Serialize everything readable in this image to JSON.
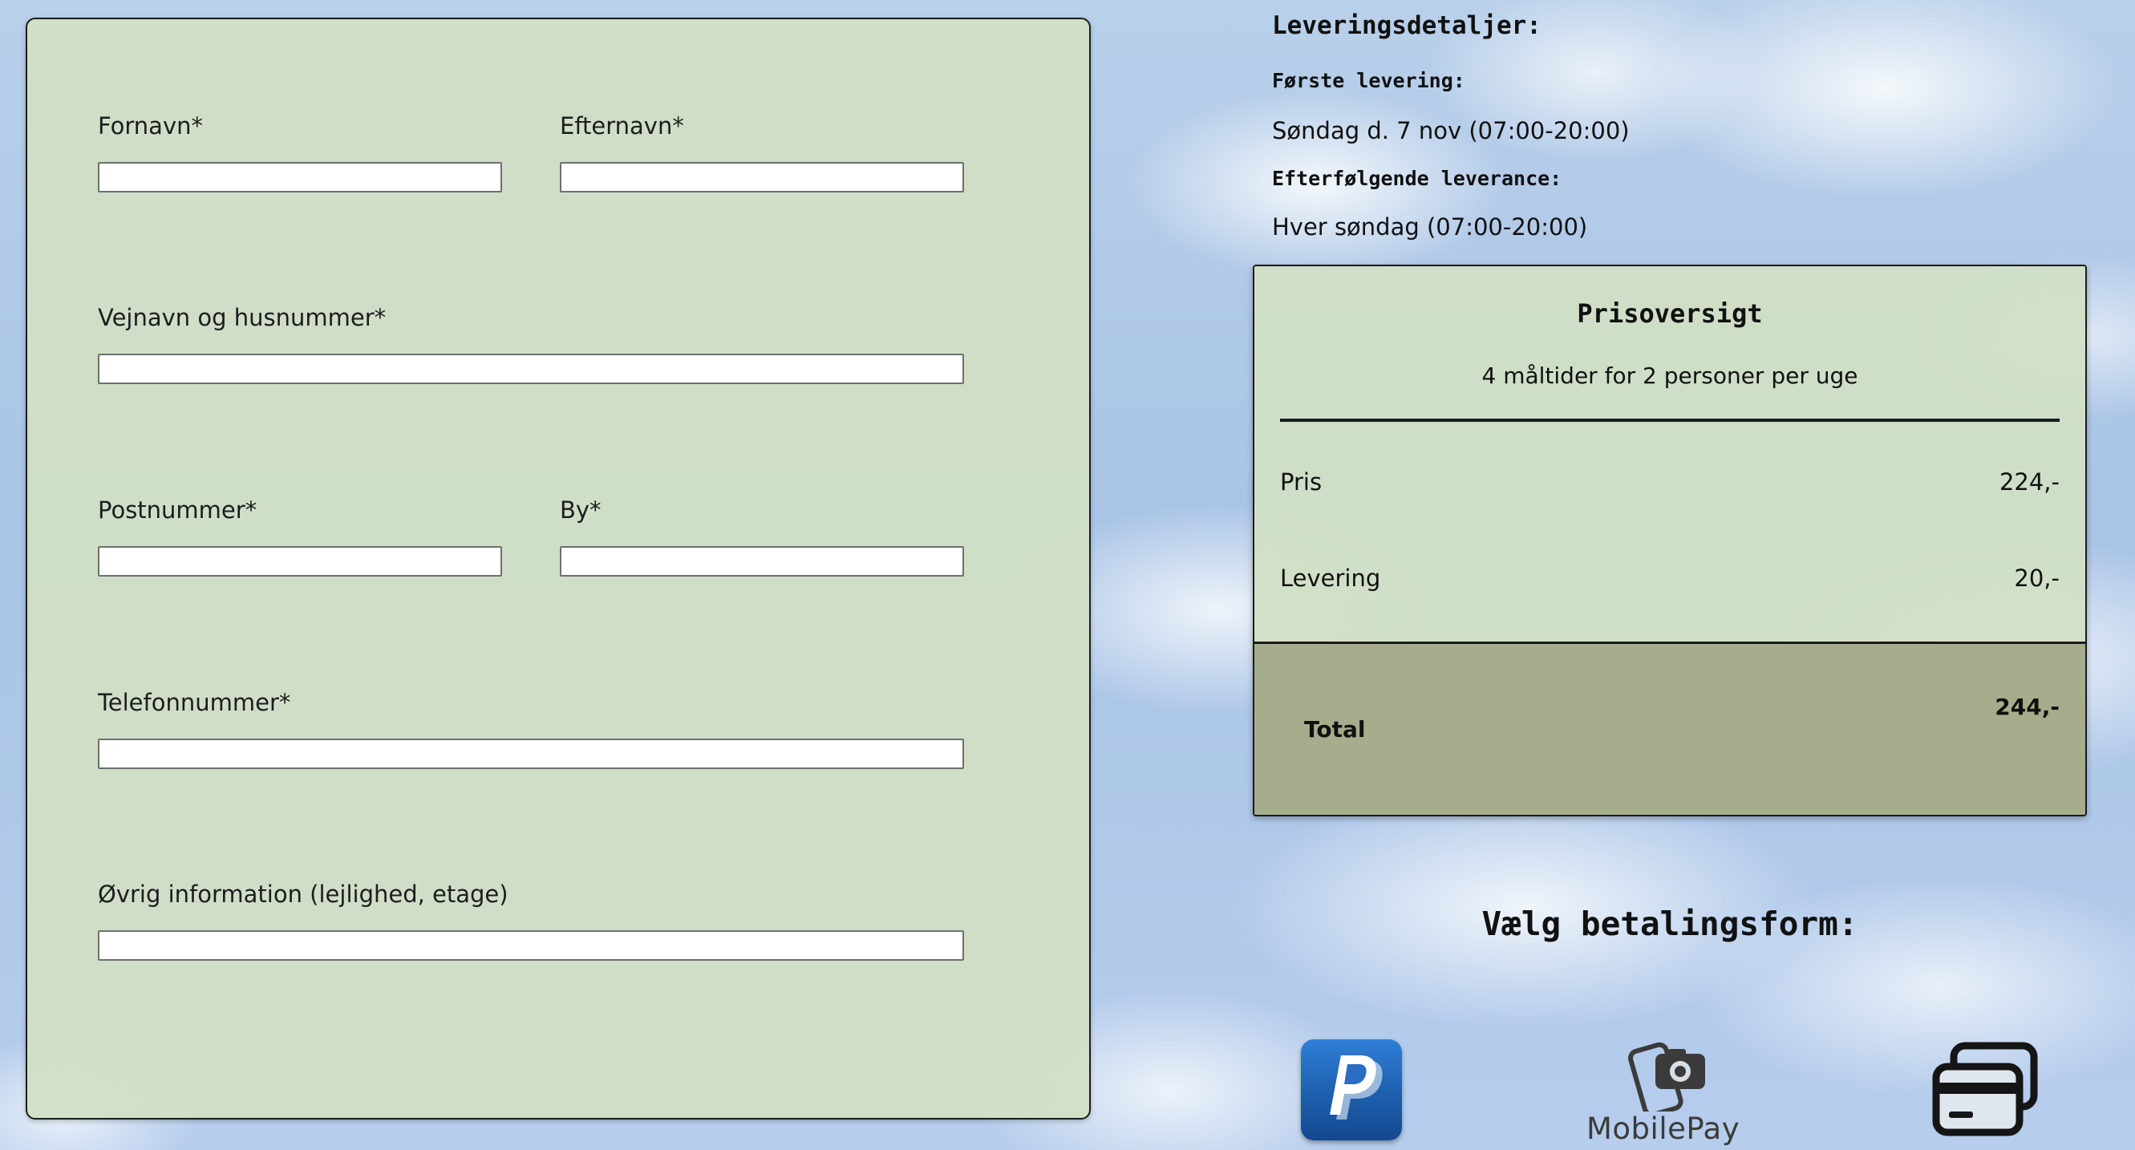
{
  "form": {
    "first_name_label": "Fornavn*",
    "last_name_label": "Efternavn*",
    "street_label": "Vejnavn og husnummer*",
    "postal_code_label": "Postnummer*",
    "city_label": "By*",
    "phone_label": "Telefonnummer*",
    "other_info_label": "Øvrig information (lejlighed, etage)",
    "first_name_value": "",
    "last_name_value": "",
    "street_value": "",
    "postal_code_value": "",
    "city_value": "",
    "phone_value": "",
    "other_info_value": ""
  },
  "delivery": {
    "title": "Leveringsdetaljer:",
    "first_label": "Første levering:",
    "first_value": "Søndag d. 7 nov (07:00-20:00)",
    "subsequent_label": "Efterfølgende leverance:",
    "subsequent_value": "Hver søndag (07:00-20:00)"
  },
  "price": {
    "title": "Prisoversigt",
    "subtitle": "4 måltider for 2 personer per uge",
    "rows": [
      {
        "label": "Pris",
        "value": "224,-"
      },
      {
        "label": "Levering",
        "value": "20,-"
      }
    ],
    "total_label": "Total",
    "total_value": "244,-"
  },
  "payment": {
    "title": "Vælg betalingsform:",
    "options": [
      {
        "icon": "paypal-icon"
      },
      {
        "icon": "mobilepay-icon",
        "label": "MobilePay"
      },
      {
        "icon": "credit-card-icon"
      }
    ]
  },
  "colors": {
    "panel": "#d2e0c4",
    "total_bg": "#a6ad8c",
    "paypal_blue": "#1d5fae"
  }
}
